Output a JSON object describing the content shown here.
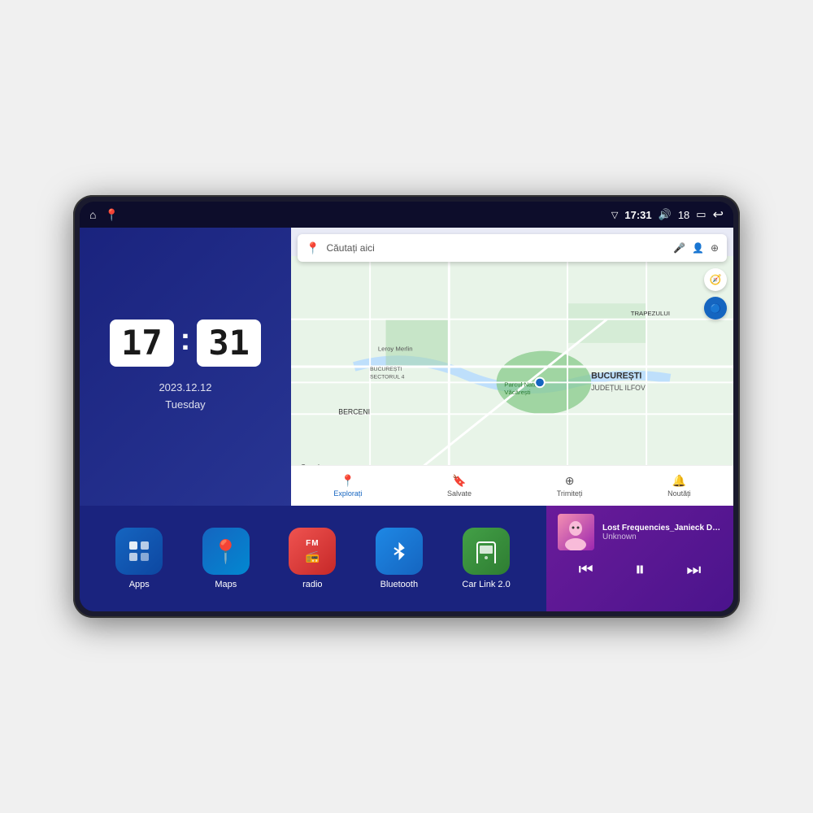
{
  "status_bar": {
    "signal_icon": "▽",
    "time": "17:31",
    "volume_icon": "🔊",
    "volume_level": "18",
    "battery_icon": "▭",
    "back_icon": "↩"
  },
  "clock": {
    "hours": "17",
    "minutes": "31",
    "date": "2023.12.12",
    "day": "Tuesday"
  },
  "map": {
    "search_placeholder": "Căutați aici",
    "nav_items": [
      {
        "label": "Explorați",
        "icon": "📍",
        "active": true
      },
      {
        "label": "Salvate",
        "icon": "🔖",
        "active": false
      },
      {
        "label": "Trimiteți",
        "icon": "⊕",
        "active": false
      },
      {
        "label": "Noutăți",
        "icon": "🔔",
        "active": false
      }
    ],
    "location_label": "BUCUREȘTI",
    "sublocation": "JUDEȚUL ILFOV",
    "area1": "BERCENI",
    "area2": "TRAPEZULUI",
    "park_label": "Parcul Natural Văcărești",
    "store_label": "Leroy Merlin",
    "district": "BUCUREȘTI SECTORUL 4",
    "google_label": "Google"
  },
  "apps": [
    {
      "label": "Apps",
      "icon": "⊞",
      "bg_class": "apps-bg",
      "emoji": "⊞"
    },
    {
      "label": "Maps",
      "icon": "📍",
      "bg_class": "maps-bg",
      "emoji": "📍"
    },
    {
      "label": "radio",
      "icon": "📻",
      "bg_class": "radio-bg",
      "emoji": "📻"
    },
    {
      "label": "Bluetooth",
      "icon": "₿",
      "bg_class": "bt-bg",
      "emoji": "🔵"
    },
    {
      "label": "Car Link 2.0",
      "icon": "📱",
      "bg_class": "carlink-bg",
      "emoji": "📱"
    }
  ],
  "music": {
    "title": "Lost Frequencies_Janieck Devy-...",
    "artist": "Unknown",
    "prev_icon": "⏮",
    "play_icon": "⏸",
    "next_icon": "⏭"
  }
}
